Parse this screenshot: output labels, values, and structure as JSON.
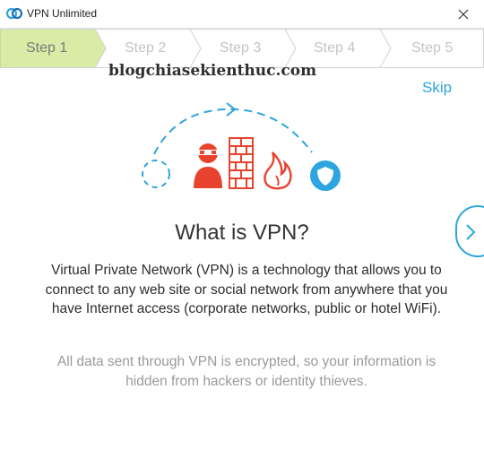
{
  "window": {
    "title": "VPN Unlimited",
    "app_icon": "vpn-unlimited-logo-icon",
    "close_icon": "close-x-icon"
  },
  "steps": [
    {
      "label": "Step 1",
      "active": true
    },
    {
      "label": "Step 2",
      "active": false
    },
    {
      "label": "Step 3",
      "active": false
    },
    {
      "label": "Step 4",
      "active": false
    },
    {
      "label": "Step 5",
      "active": false
    }
  ],
  "watermark": "blogchiasekienthuc.com",
  "skip_label": "Skip",
  "illustration": {
    "icons": [
      "dashed-circle-icon",
      "hacker-icon",
      "brick-firewall-icon",
      "fire-icon",
      "shield-icon"
    ]
  },
  "headline": "What is VPN?",
  "description": "Virtual Private Network (VPN) is a technology that allows you to connect to any web site or social network from anywhere that you have Internet access (corporate networks, public or hotel WiFi).",
  "note": "All data sent through VPN is encrypted, so your information is hidden from hackers or identity thieves.",
  "next_icon": "chevron-right-icon",
  "colors": {
    "accent": "#2ea5de",
    "active_step": "#d8eca6",
    "danger": "#e8432e",
    "text_primary": "#333333",
    "text_muted": "#9a9a9a"
  }
}
